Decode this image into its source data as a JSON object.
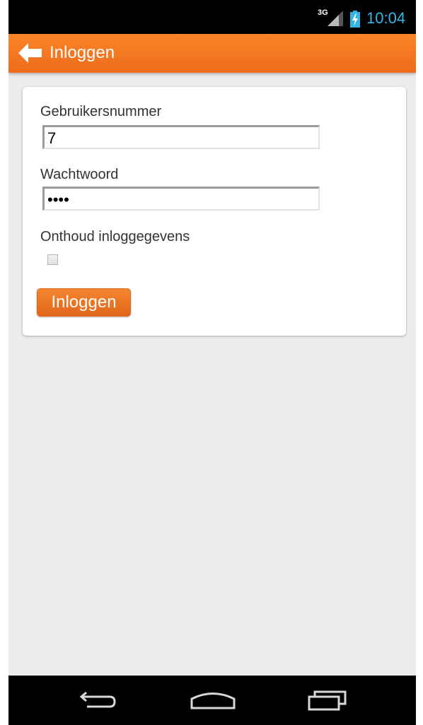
{
  "status_bar": {
    "network_type": "3G",
    "signal_icon": "signal-strength-icon",
    "battery_icon": "battery-charging-icon",
    "time": "10:04",
    "time_color": "#33b5e5"
  },
  "action_bar": {
    "back_icon": "arrow-left-icon",
    "title": "Inloggen",
    "color": "#f47b24"
  },
  "form": {
    "username_label": "Gebruikersnummer",
    "username_value": "7",
    "password_label": "Wachtwoord",
    "password_value": "1234",
    "remember_label": "Onthoud inloggegevens",
    "remember_checked": false,
    "submit_label": "Inloggen"
  },
  "nav_bar": {
    "back_icon": "back-icon",
    "home_icon": "home-icon",
    "recents_icon": "recent-apps-icon"
  }
}
